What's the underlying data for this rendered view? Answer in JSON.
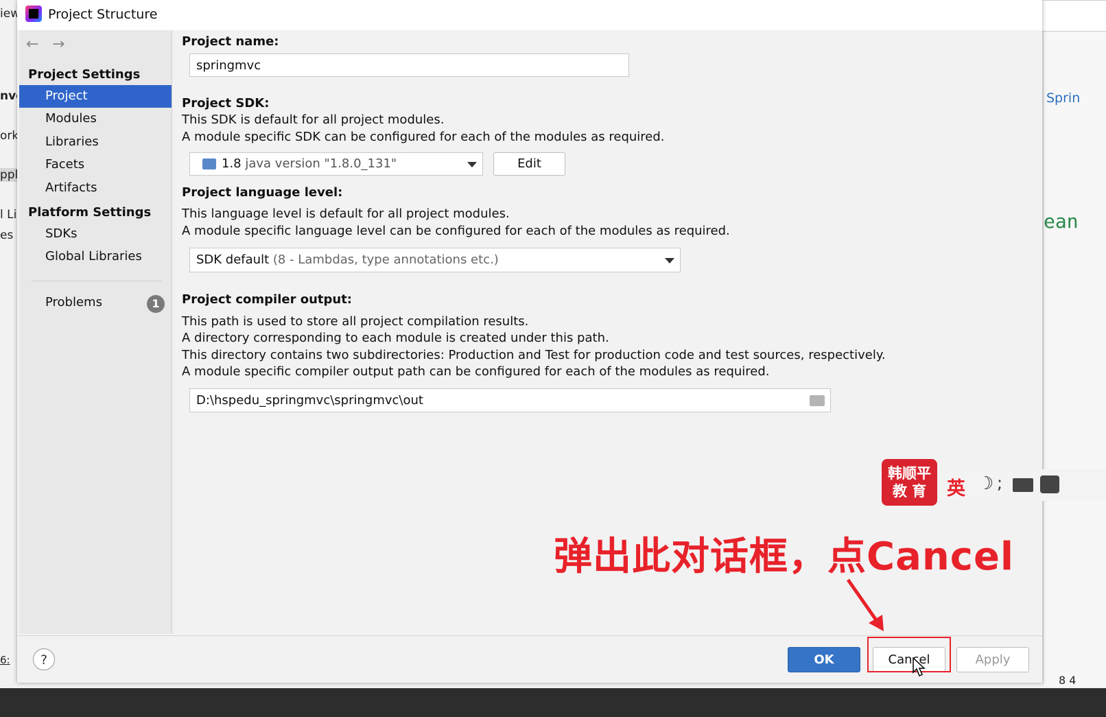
{
  "dialog": {
    "title": "Project Structure"
  },
  "background": {
    "left_texts": [
      "iew",
      "nvc",
      "ork",
      "ppl",
      "l Lib",
      "es a"
    ],
    "right_link": "Sprin",
    "right_word": "ean",
    "bottom_left": "6:",
    "bottom_right": "8   4"
  },
  "sidebar": {
    "project_settings_title": "Project Settings",
    "project_items": [
      {
        "label": "Project",
        "selected": true
      },
      {
        "label": "Modules"
      },
      {
        "label": "Libraries"
      },
      {
        "label": "Facets"
      },
      {
        "label": "Artifacts"
      }
    ],
    "platform_settings_title": "Platform Settings",
    "platform_items": [
      {
        "label": "SDKs"
      },
      {
        "label": "Global Libraries"
      }
    ],
    "problems": {
      "label": "Problems",
      "count": "1"
    }
  },
  "content": {
    "project_name": {
      "label": "Project name:",
      "value": "springmvc"
    },
    "project_sdk": {
      "label": "Project SDK:",
      "desc1": "This SDK is default for all project modules.",
      "desc2": "A module specific SDK can be configured for each of the modules as required.",
      "selected_version": "1.8",
      "selected_detail": "java version \"1.8.0_131\"",
      "edit_label": "Edit"
    },
    "language_level": {
      "label": "Project language level:",
      "desc1": "This language level is default for all project modules.",
      "desc2": "A module specific language level can be configured for each of the modules as required.",
      "selected": "SDK default",
      "selected_detail": "(8 - Lambdas, type annotations etc.)"
    },
    "compiler_output": {
      "label": "Project compiler output:",
      "desc1": "This path is used to store all project compilation results.",
      "desc2": "A directory corresponding to each module is created under this path.",
      "desc3": "This directory contains two subdirectories: Production and Test for production code and test sources, respectively.",
      "desc4": "A module specific compiler output path can be configured for each of the modules as required.",
      "path": "D:\\hspedu_springmvc\\springmvc\\out"
    }
  },
  "footer": {
    "help_label": "?",
    "ok_label": "OK",
    "cancel_label": "Cancel",
    "apply_label": "Apply"
  },
  "annotation": {
    "text": "弹出此对话框，点Cancel",
    "color": "#e8222a"
  },
  "watermark": {
    "line1": "韩顺平",
    "line2": "教 育"
  },
  "ime": {
    "mode": "英"
  }
}
